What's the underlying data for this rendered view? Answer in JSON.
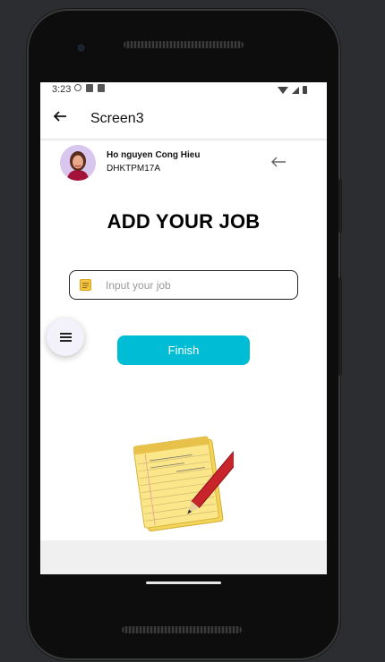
{
  "status_bar": {
    "time": "3:23"
  },
  "app_bar": {
    "title": "Screen3"
  },
  "user": {
    "name": "Ho nguyen Cong Hieu",
    "id": "DHKTPM17A"
  },
  "main": {
    "heading": "ADD YOUR JOB",
    "job_input": {
      "placeholder": "Input your job",
      "value": ""
    },
    "finish_label": "Finish"
  },
  "colors": {
    "accent": "#00bcd4",
    "fab_bg": "#f3f1f9",
    "screen_bg": "#ffffff",
    "bottom_bar": "#f0f0f0"
  },
  "icons": {
    "back": "arrow-left-icon",
    "logout": "arrow-left-icon",
    "note": "note-icon",
    "menu": "menu-icon",
    "illustration": "notepad-pencil-icon"
  }
}
